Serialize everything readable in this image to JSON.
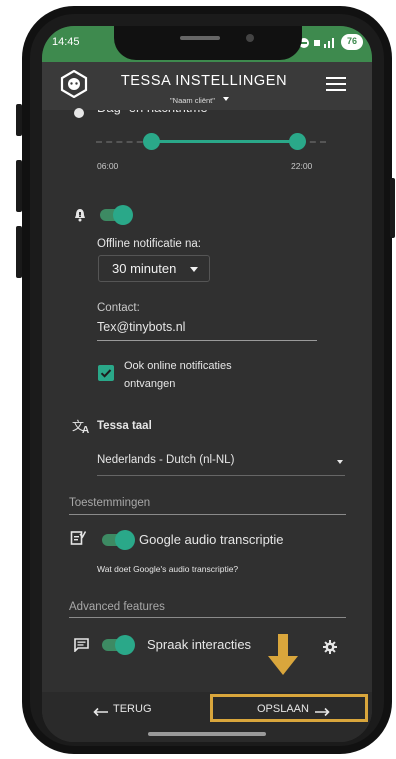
{
  "status": {
    "time": "14:45",
    "battery": "76"
  },
  "header": {
    "title": "TESSA INSTELLINGEN",
    "subtitle": "\"Naam cliënt\""
  },
  "day_night": {
    "label": "Dag- en nachtritme",
    "start_time": "06:00",
    "end_time": "22:00"
  },
  "notification": {
    "offline_label": "Offline notificatie na:",
    "offline_value": "30 minuten",
    "contact_label": "Contact:",
    "contact_value": "Tex@tinybots.nl",
    "online_checkbox_label": "Ook online notificaties ontvangen"
  },
  "language": {
    "label": "Tessa taal",
    "value": "Nederlands - Dutch (nl-NL)"
  },
  "permissions": {
    "section_title": "Toestemmingen",
    "google_label": "Google audio transcriptie",
    "google_help": "Wat doet Google's audio transcriptie?"
  },
  "advanced": {
    "section_title": "Advanced features",
    "speech_label": "Spraak interacties"
  },
  "footer": {
    "back_label": "TERUG",
    "save_label": "OPSLAAN"
  },
  "colors": {
    "accent_green": "#2aa889",
    "highlight": "#d9a63c",
    "status_bar": "#3e8a4e"
  }
}
